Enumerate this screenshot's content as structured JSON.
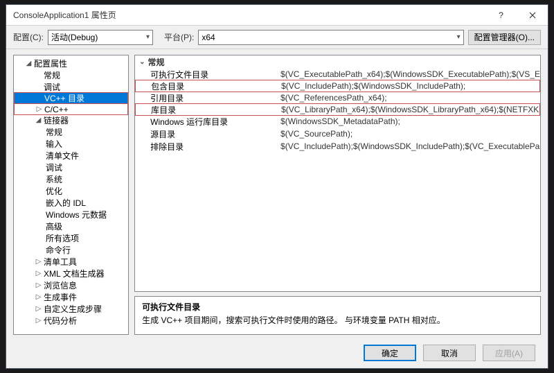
{
  "titlebar": {
    "title": "ConsoleApplication1 属性页"
  },
  "toolbar": {
    "config_label": "配置(C):",
    "config_value": "活动(Debug)",
    "platform_label": "平台(P):",
    "platform_value": "x64",
    "config_manager": "配置管理器(O)..."
  },
  "tree": {
    "root": "配置属性",
    "items": [
      "常规",
      "调试",
      "VC++ 目录",
      "C/C++"
    ],
    "linker": "链接器",
    "linker_items": [
      "常规",
      "输入",
      "清单文件",
      "调试",
      "系统",
      "优化",
      "嵌入的 IDL",
      "Windows 元数据",
      "高级",
      "所有选项",
      "命令行"
    ],
    "rest": [
      "清单工具",
      "XML 文档生成器",
      "浏览信息",
      "生成事件",
      "自定义生成步骤",
      "代码分析"
    ]
  },
  "grid": {
    "header": "常规",
    "rows": [
      {
        "name": "可执行文件目录",
        "val": "$(VC_ExecutablePath_x64);$(WindowsSDK_ExecutablePath);$(VS_E"
      },
      {
        "name": "包含目录",
        "val": "$(VC_IncludePath);$(WindowsSDK_IncludePath);"
      },
      {
        "name": "引用目录",
        "val": "$(VC_ReferencesPath_x64);"
      },
      {
        "name": "库目录",
        "val": "$(VC_LibraryPath_x64);$(WindowsSDK_LibraryPath_x64);$(NETFXK"
      },
      {
        "name": "Windows 运行库目录",
        "val": "$(WindowsSDK_MetadataPath);"
      },
      {
        "name": "源目录",
        "val": "$(VC_SourcePath);"
      },
      {
        "name": "排除目录",
        "val": "$(VC_IncludePath);$(WindowsSDK_IncludePath);$(VC_ExecutablePa"
      }
    ]
  },
  "desc": {
    "title": "可执行文件目录",
    "text": "生成 VC++ 项目期间，搜索可执行文件时使用的路径。   与环境变量 PATH 相对应。"
  },
  "footer": {
    "ok": "确定",
    "cancel": "取消",
    "apply": "应用(A)"
  }
}
